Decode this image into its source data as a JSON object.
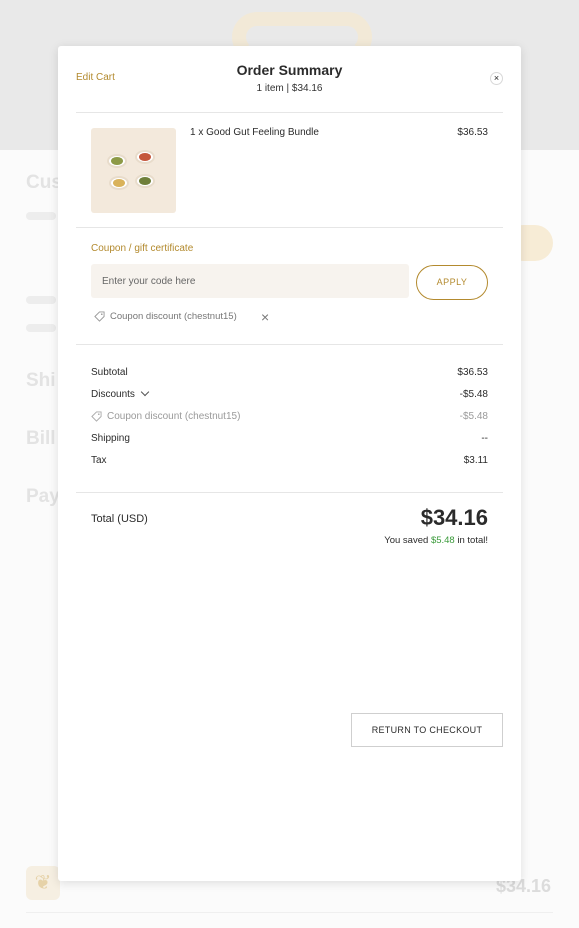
{
  "modal": {
    "edit_cart_label": "Edit Cart",
    "title": "Order Summary",
    "subtitle": "1 item | $34.16",
    "close_icon": "×"
  },
  "item": {
    "name": "1 x Good Gut Feeling Bundle",
    "price": "$36.53"
  },
  "coupon": {
    "label": "Coupon / gift certificate",
    "placeholder": "Enter your code here",
    "apply_label": "APPLY",
    "applied_label": "Coupon discount (chestnut15)",
    "remove_icon": "×"
  },
  "summary": {
    "subtotal_label": "Subtotal",
    "subtotal_value": "$36.53",
    "discounts_label": "Discounts",
    "discounts_value": "-$5.48",
    "coupon_label": "Coupon discount (chestnut15)",
    "coupon_value": "-$5.48",
    "shipping_label": "Shipping",
    "shipping_value": "--",
    "tax_label": "Tax",
    "tax_value": "$3.11"
  },
  "total": {
    "label": "Total (USD)",
    "value": "$34.16",
    "saved_prefix": "You saved ",
    "saved_amount": "$5.48",
    "saved_suffix": " in total!"
  },
  "return_button_label": "RETURN TO CHECKOUT",
  "background": {
    "footer_total": "$34.16",
    "footer_icon": "leaf"
  },
  "colors": {
    "accent": "#b38a2e",
    "savings_green": "#3a9a3a",
    "overlay_header": "#e9e9e9"
  }
}
